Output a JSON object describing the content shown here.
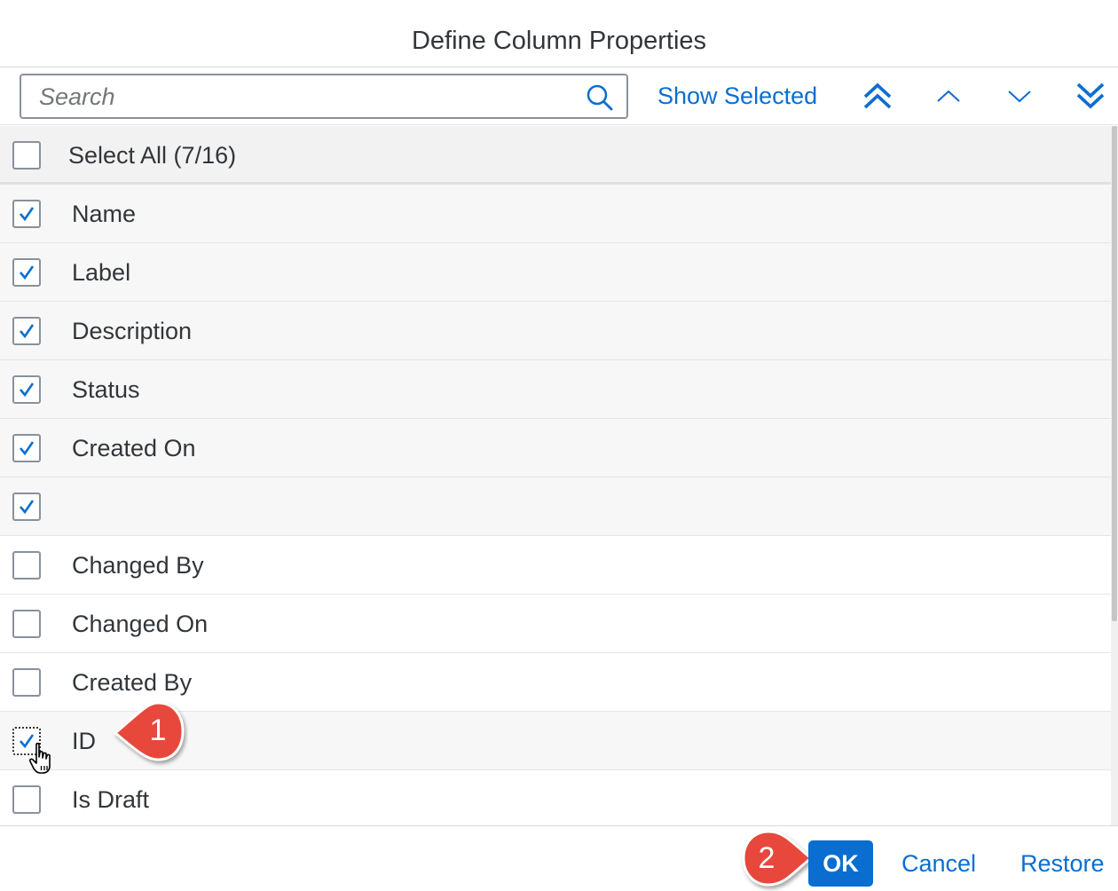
{
  "dialog": {
    "title": "Define Column Properties"
  },
  "toolbar": {
    "search_placeholder": "Search",
    "show_selected_label": "Show Selected"
  },
  "select_all": {
    "label": "Select All (7/16)",
    "checked": false
  },
  "items": [
    {
      "label": "Name",
      "checked": true
    },
    {
      "label": "Label",
      "checked": true
    },
    {
      "label": "Description",
      "checked": true
    },
    {
      "label": "Status",
      "checked": true
    },
    {
      "label": "Created On",
      "checked": true
    },
    {
      "label": "",
      "checked": true
    },
    {
      "label": "Changed By",
      "checked": false
    },
    {
      "label": "Changed On",
      "checked": false
    },
    {
      "label": "Created By",
      "checked": false
    },
    {
      "label": "ID",
      "checked": true
    },
    {
      "label": "Is Draft",
      "checked": false
    }
  ],
  "footer": {
    "ok_label": "OK",
    "cancel_label": "Cancel",
    "restore_label": "Restore"
  },
  "callouts": [
    {
      "number": "1"
    },
    {
      "number": "2"
    }
  ],
  "colors": {
    "accent": "#0a6ed1",
    "callout": "#e8473c",
    "text": "#32363a"
  }
}
